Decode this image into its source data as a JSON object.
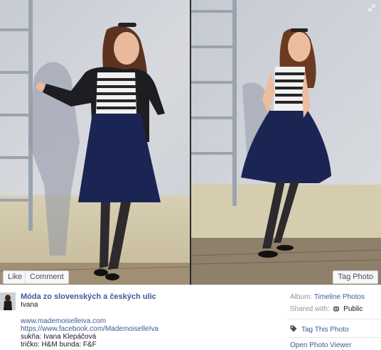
{
  "actions": {
    "like_label": "Like",
    "comment_label": "Comment",
    "tag_photo_label": "Tag Photo"
  },
  "post": {
    "page_name": "Móda zo slovenských a českých ulic",
    "uploader": "Ivana",
    "description_lines": [
      "www.mademoiselleiva.com",
      "https://www.facebook.com/MademoiselleIva",
      "sukňa: Ivana Klepáčová",
      "tričko: H&M bunda: F&F"
    ]
  },
  "meta": {
    "album_label": "Album:",
    "album_value": "Timeline Photos",
    "shared_label": "Shared with:",
    "shared_value": "Public",
    "tag_this_photo": "Tag This Photo",
    "open_viewer": "Open Photo Viewer"
  },
  "icons": {
    "expand": "expand-icon",
    "globe": "globe-icon",
    "tag": "tag-icon"
  }
}
